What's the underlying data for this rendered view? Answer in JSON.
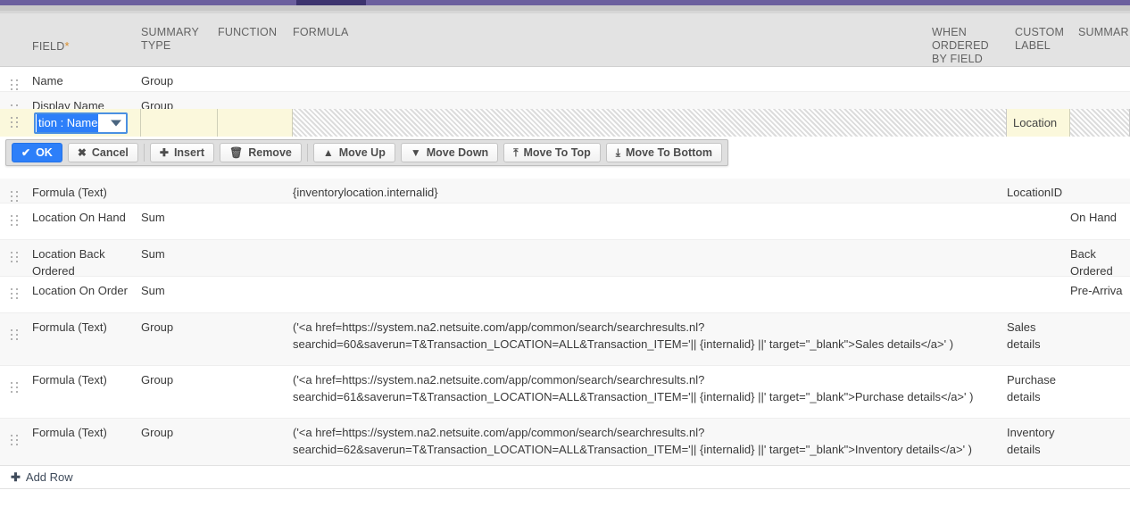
{
  "chrome": {
    "purple_bar_color": "#6b5f9e",
    "active_tab_color": "#3c336e"
  },
  "table": {
    "headers": {
      "field": "FIELD",
      "field_required_marker": "*",
      "summary_type": "SUMMARY\nTYPE",
      "function": "FUNCTION",
      "formula": "FORMULA",
      "when_ordered_by_field": "WHEN\nORDERED\nBY FIELD",
      "custom_label": "CUSTOM\nLABEL",
      "summary_label": "SUMMAR"
    },
    "rows": [
      {
        "field": "Name",
        "summary_type": "Group",
        "function": "",
        "formula": "",
        "custom_label": "",
        "summary_label": ""
      },
      {
        "field": "Display Name",
        "summary_type": "Group",
        "function": "",
        "formula": "",
        "custom_label": "",
        "summary_label": ""
      },
      {
        "field": "Formula (Text)",
        "summary_type": "",
        "function": "",
        "formula": "{inventorylocation.internalid}",
        "custom_label": "LocationID",
        "summary_label": ""
      },
      {
        "field": "Location On Hand",
        "summary_type": "Sum",
        "function": "",
        "formula": "",
        "custom_label": "",
        "summary_label": "On Hand"
      },
      {
        "field": "Location Back Ordered",
        "summary_type": "Sum",
        "function": "",
        "formula": "",
        "custom_label": "",
        "summary_label": "Back Ordered"
      },
      {
        "field": "Location On Order",
        "summary_type": "Sum",
        "function": "",
        "formula": "",
        "custom_label": "",
        "summary_label": "Pre-Arriva"
      },
      {
        "field": "Formula (Text)",
        "summary_type": "Group",
        "function": "",
        "formula": "('<a href=https://system.na2.netsuite.com/app/common/search/searchresults.nl?searchid=60&saverun=T&Transaction_LOCATION=ALL&Transaction_ITEM='|| {internalid} ||' target=\"_blank\">Sales details</a>' )",
        "custom_label": "Sales details",
        "summary_label": ""
      },
      {
        "field": "Formula (Text)",
        "summary_type": "Group",
        "function": "",
        "formula": "('<a href=https://system.na2.netsuite.com/app/common/search/searchresults.nl?searchid=61&saverun=T&Transaction_LOCATION=ALL&Transaction_ITEM='|| {internalid} ||' target=\"_blank\">Purchase details</a>' )",
        "custom_label": "Purchase details",
        "summary_label": ""
      },
      {
        "field": "Formula (Text)",
        "summary_type": "Group",
        "function": "",
        "formula": "('<a href=https://system.na2.netsuite.com/app/common/search/searchresults.nl?searchid=62&saverun=T&Transaction_LOCATION=ALL&Transaction_ITEM='|| {internalid} ||' target=\"_blank\">Inventory details</a>' )",
        "custom_label": "Inventory details",
        "summary_label": ""
      }
    ]
  },
  "edit_row": {
    "field_select_value": "tion : Name",
    "summary_type_value": "",
    "function_value": "",
    "custom_label_value": "Location"
  },
  "action_buttons": [
    {
      "label": "OK",
      "icon": "check-icon",
      "glyph": "✔",
      "primary": true
    },
    {
      "label": "Cancel",
      "icon": "close-icon",
      "glyph": "✖",
      "primary": false
    },
    {
      "label": "Insert",
      "icon": "plus-icon",
      "glyph": "✚",
      "primary": false
    },
    {
      "label": "Remove",
      "icon": "trash-icon",
      "glyph": "🗑",
      "primary": false
    },
    {
      "label": "Move Up",
      "icon": "arrow-up-icon",
      "glyph": "▲",
      "primary": false
    },
    {
      "label": "Move Down",
      "icon": "arrow-down-icon",
      "glyph": "▼",
      "primary": false
    },
    {
      "label": "Move To Top",
      "icon": "arrow-to-top-icon",
      "glyph": "⤒",
      "primary": false
    },
    {
      "label": "Move To Bottom",
      "icon": "arrow-to-bottom-icon",
      "glyph": "⤓",
      "primary": false
    }
  ],
  "footer": {
    "add_row_label": "Add Row",
    "add_row_icon": "plus-icon"
  }
}
